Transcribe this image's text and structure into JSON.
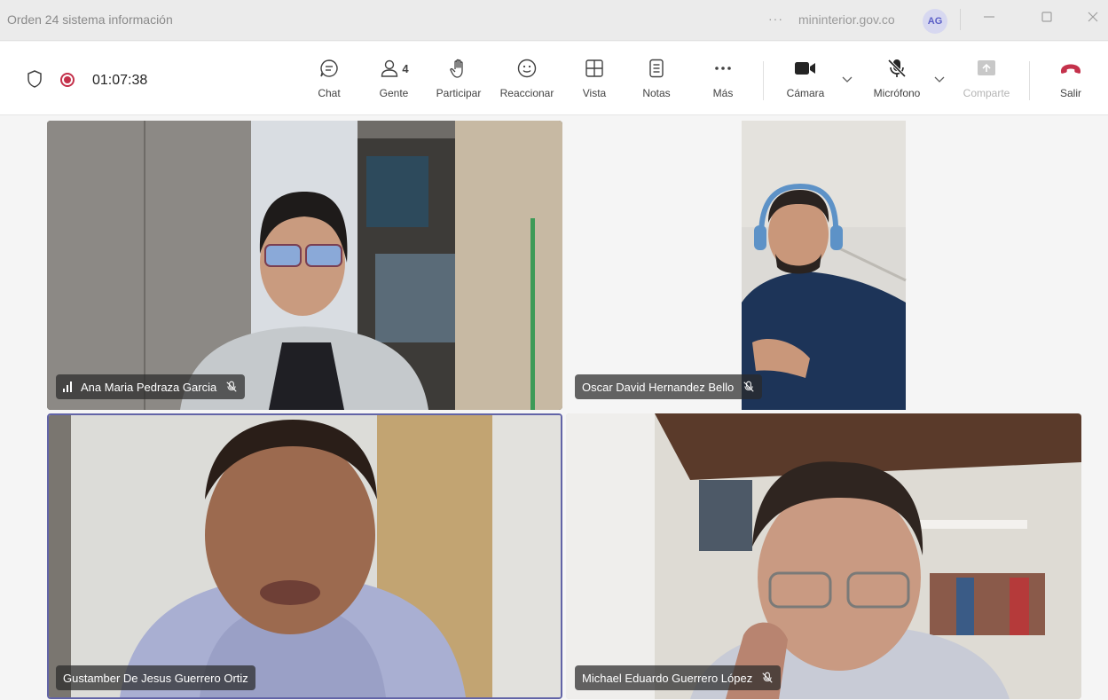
{
  "window": {
    "title": "Orden 24 sistema información",
    "more_glyph": "···",
    "domain": "mininterior.gov.co",
    "avatar_initials": "AG"
  },
  "meeting": {
    "elapsed": "01:07:38",
    "recording_color": "#c4314b",
    "people_count": "4"
  },
  "toolbar": {
    "chat": "Chat",
    "people": "Gente",
    "raise_hand": "Participar",
    "react": "Reaccionar",
    "view": "Vista",
    "notes": "Notas",
    "more": "Más",
    "camera": "Cámara",
    "mic": "Micrófono",
    "share": "Comparte",
    "leave": "Salir"
  },
  "participants": [
    {
      "name": "Ana Maria Pedraza Garcia",
      "muted": true,
      "speaking_indicator": true
    },
    {
      "name": "Oscar David Hernandez Bello",
      "muted": true
    },
    {
      "name": "Gustamber De Jesus Guerrero Ortiz",
      "muted": false,
      "active": true
    },
    {
      "name": "Michael Eduardo Guerrero López",
      "muted": true
    }
  ],
  "colors": {
    "accent": "#6264a7",
    "leave": "#c4314b"
  }
}
